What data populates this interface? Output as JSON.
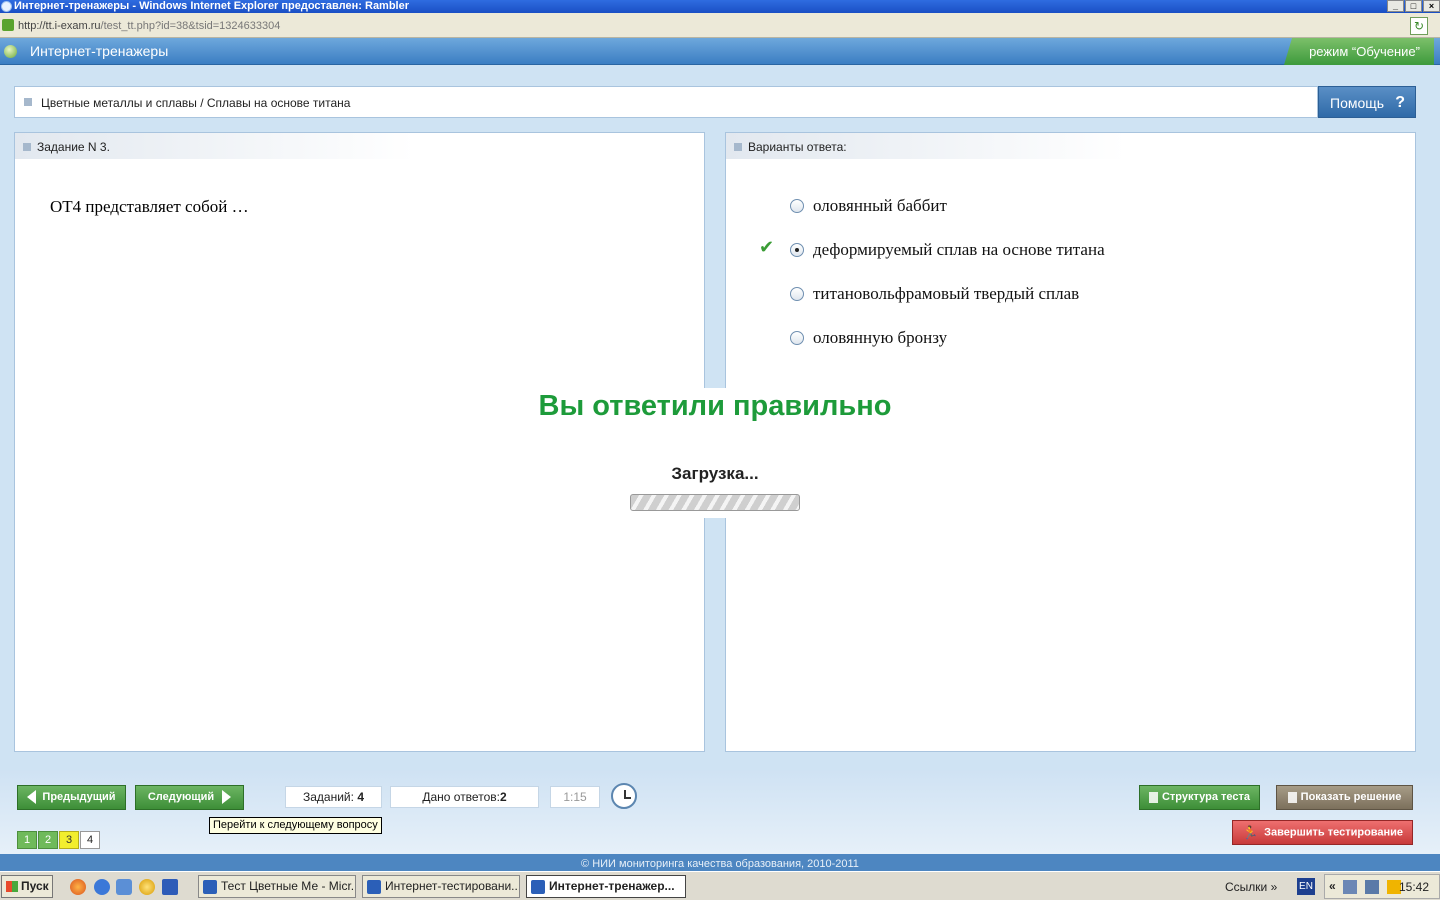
{
  "window": {
    "title": "Интернет-тренажеры - Windows Internet Explorer предоставлен: Rambler",
    "address_host": "http://tt.i-exam.ru",
    "address_path": "/test_tt.php?id=38&tsid=1324633304"
  },
  "app": {
    "title": "Интернет-тренажеры",
    "mode": "режим “Обучение”",
    "breadcrumb": "Цветные металлы и сплавы / Сплавы на основе титана",
    "help_label": "Помощь",
    "help_mark": "?"
  },
  "task": {
    "header": "Задание N 3.",
    "question": "ОТ4 представляет собой …"
  },
  "answers": {
    "header": "Варианты ответа:",
    "options": [
      {
        "text": "оловянный баббит",
        "selected": false
      },
      {
        "text": "деформируемый сплав на основе титана",
        "selected": true
      },
      {
        "text": "титановольфрамовый твердый сплав",
        "selected": false
      },
      {
        "text": "оловянную бронзу",
        "selected": false
      }
    ],
    "check_mark": "✔"
  },
  "overlay": {
    "result": "Вы ответили правильно",
    "loading": "Загрузка..."
  },
  "nav": {
    "prev_label": "Предыдущий",
    "next_label": "Следующий",
    "tasks_label": "Заданий:",
    "tasks_value": "4",
    "answered_label": "Дано ответов:",
    "answered_value": "2",
    "timer": "1:15",
    "tooltip": "Перейти к следующему вопросу",
    "pages": [
      {
        "label": "1",
        "state": "done"
      },
      {
        "label": "2",
        "state": "done"
      },
      {
        "label": "3",
        "state": "current"
      },
      {
        "label": "4",
        "state": "todo"
      }
    ],
    "structure_label": "Структура теста",
    "show_solution_label": "Показать решение",
    "finish_label": "Завершить тестирование"
  },
  "footer": "© НИИ мониторинга качества образования, 2010-2011",
  "taskbar": {
    "start": "Пуск",
    "tasks": [
      "Тест Цветные Ме - Micr...",
      "Интернет-тестировани...",
      "Интернет-тренажер..."
    ],
    "links": "Ссылки",
    "links_chevron": "»",
    "lang": "EN",
    "tray_chevron": "«",
    "time": "15:42"
  },
  "colors": {
    "correct_text": "#1d9b3a",
    "page_done": "#6fba5b",
    "page_current": "#f2ee2e",
    "finish_button": "#c83a3a"
  }
}
